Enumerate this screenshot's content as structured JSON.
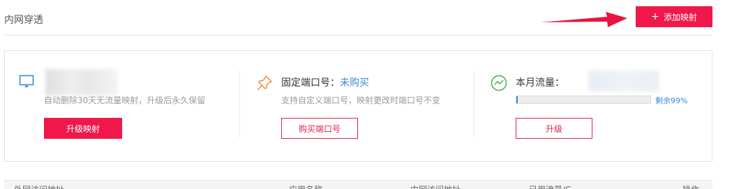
{
  "header": {
    "title": "内网穿透",
    "add_button_label": "添加映射"
  },
  "cards": {
    "upgrade": {
      "subtitle": "自动删除30天无流量映射，升级后永久保留",
      "button_label": "升级映射"
    },
    "port": {
      "title": "固定端口号：",
      "status": "未购买",
      "subtitle": "支持自定义端口号，映射更改时端口号不变",
      "button_label": "购买端口号"
    },
    "traffic": {
      "title": "本月流量：",
      "remaining_text": "剩余99%",
      "used_fraction": 0.01,
      "button_label": "升级"
    }
  },
  "table": {
    "headers": [
      "外网访问地址",
      "应用名称",
      "内网访问地址",
      "已用流量/G",
      "操作"
    ]
  },
  "colors": {
    "accent": "#f0174a",
    "link_blue": "#3b8ad9"
  },
  "icons": {
    "upgrade": "monitor-icon",
    "port": "pin-icon",
    "traffic": "traffic-chart-icon"
  }
}
